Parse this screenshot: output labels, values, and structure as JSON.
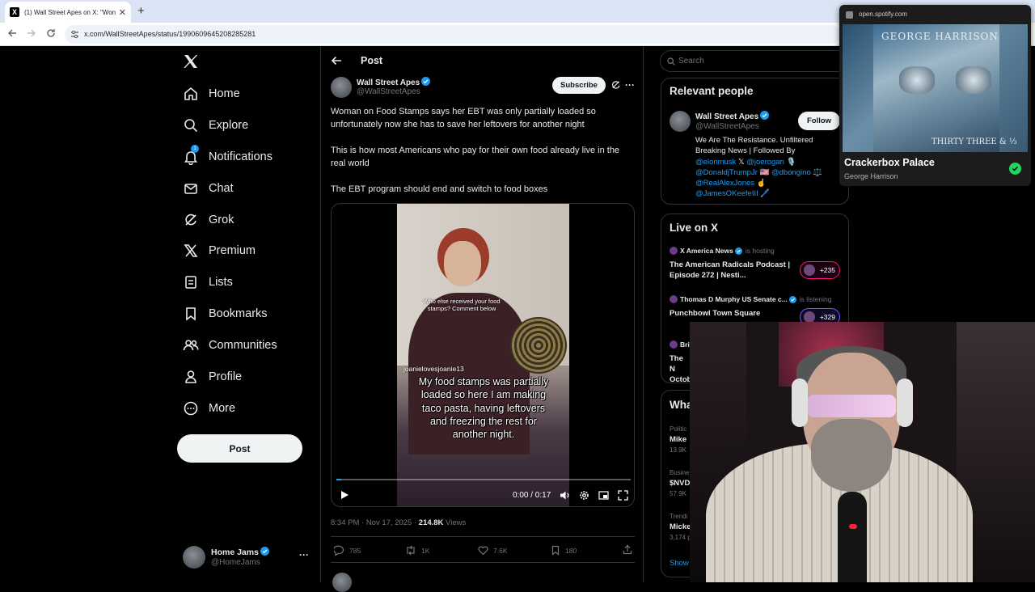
{
  "browser": {
    "tab_title": "(1) Wall Street Apes on X: \"Won",
    "tab_favicon": "X",
    "new_tab_glyph": "+",
    "url": "x.com/WallStreetApes/status/1990609645208285281"
  },
  "sidebar": {
    "items": [
      {
        "label": "Home",
        "icon": "home-icon"
      },
      {
        "label": "Explore",
        "icon": "search-icon"
      },
      {
        "label": "Notifications",
        "icon": "bell-icon",
        "badge": "1"
      },
      {
        "label": "Chat",
        "icon": "mail-icon"
      },
      {
        "label": "Grok",
        "icon": "grok-icon"
      },
      {
        "label": "Premium",
        "icon": "x-logo-icon"
      },
      {
        "label": "Lists",
        "icon": "list-icon"
      },
      {
        "label": "Bookmarks",
        "icon": "bookmark-icon"
      },
      {
        "label": "Communities",
        "icon": "people-icon"
      },
      {
        "label": "Profile",
        "icon": "person-icon"
      },
      {
        "label": "More",
        "icon": "more-circle-icon"
      }
    ],
    "post_button": "Post",
    "account": {
      "name": "Home Jams",
      "handle": "@HomeJams",
      "more": "···"
    }
  },
  "post": {
    "header_title": "Post",
    "author": {
      "name": "Wall Street Apes",
      "handle": "@WallStreetApes"
    },
    "subscribe": "Subscribe",
    "more": "···",
    "text": [
      "Woman on Food Stamps says her EBT was only partially loaded so unfortunately now she has to save her leftovers for another night",
      "This is how most Americans who pay for their own food already live in the real world",
      "The EBT program should end and switch to food boxes"
    ],
    "video": {
      "caption_small": "Who else received your food stamps? Comment below",
      "watermark": "joanielovesjoanie13",
      "caption_big": "My food stamps was partially loaded so here I am making taco pasta, having leftovers and freezing the rest for another night.",
      "time": "0:00 / 0:17",
      "progress": 0.016
    },
    "timestamp": "8:34 PM · Nov 17, 2025 · ",
    "views_count": "214.8K",
    "views_label": " Views",
    "actions": {
      "replies": "785",
      "reposts": "1K",
      "likes": "7.6K",
      "bookmarks": "180"
    }
  },
  "right": {
    "search_placeholder": "Search",
    "relevant_title": "Relevant people",
    "person": {
      "name": "Wall Street Apes",
      "handle": "@WallStreetApes",
      "follow": "Follow",
      "bio_line1": "We Are The Resistance. Unfiltered Breaking News | Followed By",
      "bio_line2a": "@elonmusk",
      "bio_line2b": " 𝕏 ",
      "bio_line2c": "@joerogan",
      "bio_line2d": " 🎙️",
      "bio_line3a": "@DonaldjTrumpJr",
      "bio_line3b": " 🇺🇸 ",
      "bio_line3c": "@dbongino",
      "bio_line3d": " ⚖️",
      "bio_line4a": "@RealAlexJones",
      "bio_line4b": " ☝️",
      "bio_line5a": "@JamesOKeefeIII",
      "bio_line5b": " 🖊️"
    },
    "live_title": "Live on X",
    "live": [
      {
        "host": "X America News",
        "status": "is hosting",
        "title": "The American Radicals Podcast | Episode 272 | Nesti...",
        "count": "+235"
      },
      {
        "host": "Thomas D Murphy US Senate c...",
        "status": "is listening",
        "title": "Punchbowl Town Square",
        "count": "+329"
      },
      {
        "host": "Bri",
        "status": "",
        "title": "The N Octob",
        "count": ""
      }
    ],
    "whats_title": "Wha",
    "whats": [
      {
        "cat": "Politic",
        "title": "Mike",
        "count": "13.9K"
      },
      {
        "cat": "Busine",
        "title": "$NVD",
        "count": "57.9K"
      },
      {
        "cat": "Trendi",
        "title": "Micke",
        "count": "3,174 p"
      }
    ],
    "show_more": "Show"
  },
  "spotify": {
    "domain": "open.spotify.com",
    "album_text_top": "GEORGE HARRISON",
    "album_text_bottom": "THIRTY THREE & ⅓",
    "song": "Crackerbox Palace",
    "artist": "George Harrison"
  },
  "colors": {
    "accent": "#1d9bf0",
    "background": "#000000",
    "spotify_green": "#1ed760"
  }
}
